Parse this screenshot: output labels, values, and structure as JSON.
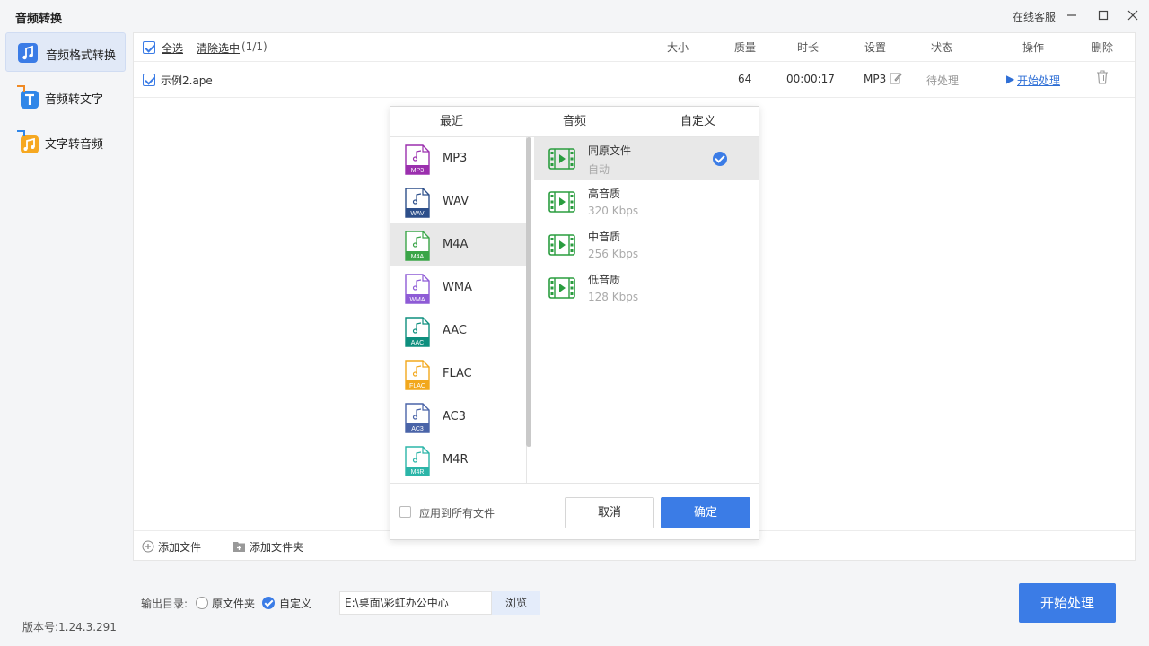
{
  "app": {
    "title": "音频转换",
    "service": "在线客服"
  },
  "window_controls": [
    "minimize-icon",
    "maximize-icon",
    "close-icon"
  ],
  "sidebar": {
    "items": [
      {
        "label": "音频格式转换",
        "icon": "audio-convert-icon",
        "active": true
      },
      {
        "label": "音频转文字",
        "icon": "speech-to-text-icon",
        "active": false
      },
      {
        "label": "文字转音频",
        "icon": "text-to-speech-icon",
        "active": false
      }
    ],
    "version": "版本号:1.24.3.291"
  },
  "table": {
    "select_all": "全选",
    "clear_selection": "清除选中",
    "selection_count": "(1/1)",
    "columns": {
      "size": "大小",
      "quality": "质量",
      "duration": "时长",
      "settings": "设置",
      "status": "状态",
      "action": "操作",
      "delete": "删除"
    },
    "rows": [
      {
        "name": "示例2.ape",
        "size": "",
        "quality": "64",
        "duration": "00:00:17",
        "format": "MP3",
        "status": "待处理",
        "action": "开始处理"
      }
    ]
  },
  "footer": {
    "add_file": "添加文件",
    "add_folder": "添加文件夹"
  },
  "dialog": {
    "tabs": [
      "最近",
      "音频",
      "自定义"
    ],
    "formats": [
      {
        "name": "MP3",
        "color": "#9b2fae",
        "selected": false
      },
      {
        "name": "WAV",
        "color": "#2d4f8a",
        "selected": false
      },
      {
        "name": "M4A",
        "color": "#3aa548",
        "selected": true
      },
      {
        "name": "WMA",
        "color": "#8e5bd6",
        "selected": false
      },
      {
        "name": "AAC",
        "color": "#0e8f7e",
        "selected": false
      },
      {
        "name": "FLAC",
        "color": "#f2a81d",
        "selected": false
      },
      {
        "name": "AC3",
        "color": "#4a64a8",
        "selected": false
      },
      {
        "name": "M4R",
        "color": "#2bb5a8",
        "selected": false
      }
    ],
    "qualities": [
      {
        "name": "同原文件",
        "sub": "自动",
        "selected": true
      },
      {
        "name": "高音质",
        "sub": "320 Kbps",
        "selected": false
      },
      {
        "name": "中音质",
        "sub": "256 Kbps",
        "selected": false
      },
      {
        "name": "低音质",
        "sub": "128 Kbps",
        "selected": false
      }
    ],
    "apply_all": "应用到所有文件",
    "cancel": "取消",
    "ok": "确定"
  },
  "output": {
    "label": "输出目录:",
    "option_original": "原文件夹",
    "option_custom": "自定义",
    "path": "E:\\桌面\\彩虹办公中心",
    "browse": "浏览"
  },
  "start_button": "开始处理",
  "colors": {
    "accent": "#3b7ce6",
    "icon_green": "#2a9d3f"
  }
}
